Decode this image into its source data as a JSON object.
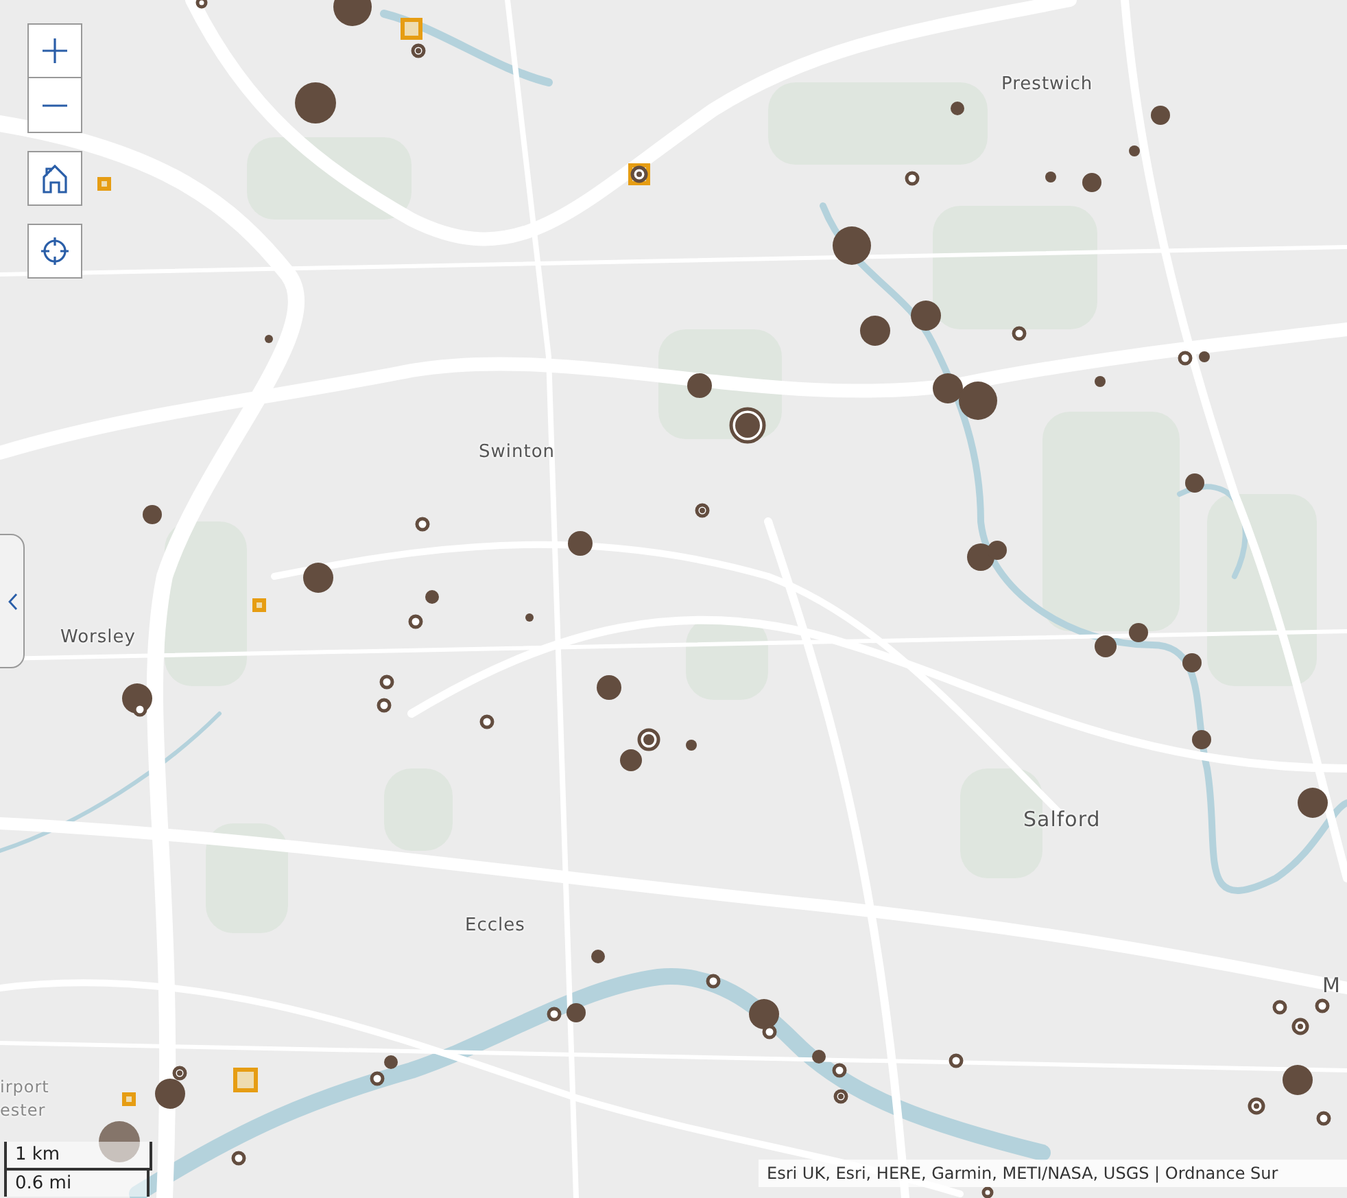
{
  "map": {
    "place_labels": [
      {
        "text": "Prestwich"
      },
      {
        "text": "Swinton"
      },
      {
        "text": "Worsley"
      },
      {
        "text": "Salford"
      },
      {
        "text": "Eccles"
      },
      {
        "text": "M"
      },
      {
        "text": "irport"
      },
      {
        "text": "ester"
      }
    ]
  },
  "scale_bar": {
    "metric": "1 km",
    "imperial": "0.6 mi"
  },
  "attribution": "Esri UK, Esri, HERE, Garmin, METI/NASA, USGS | Ordnance Sur"
}
